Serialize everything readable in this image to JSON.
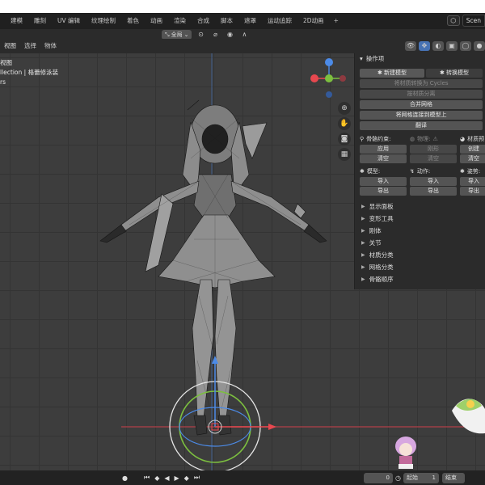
{
  "menu_tabs": [
    "建模",
    "雕刻",
    "UV 编辑",
    "纹理绘制",
    "着色",
    "动画",
    "渲染",
    "合成",
    "脚本",
    "遮罩",
    "运动追踪",
    "2D动画"
  ],
  "menu_plus": "+",
  "scene_label": "Scen",
  "header_menus": [
    "视图",
    "选择",
    "物体"
  ],
  "transform_dropdown": "全局",
  "viewport_info": {
    "line1": "视图",
    "line2": "llection | 格蕾修泳装",
    "line3": "rs"
  },
  "panel": {
    "header": "操作项",
    "new_model": "新建模型",
    "convert_model": "转换模型",
    "convert_cycles": "将材质转换为 Cycles",
    "separate_material": "按材质分离",
    "merge_mesh": "合并网格",
    "join_mesh": "将网格连接到模型上",
    "translate": "翻译",
    "bone_constraint": "骨骼约束:",
    "physics": "物理:",
    "material_short": "材质预",
    "apply": "应用",
    "clear": "清空",
    "rigid": "刚形",
    "create_short": "创建",
    "model_label": "模型:",
    "motion_label": "动作:",
    "pose_short": "姿势:",
    "import": "导入",
    "export": "导出",
    "import_short": "导入",
    "export_short": "导出",
    "sections": [
      "显示面板",
      "变形工具",
      "刚体",
      "关节",
      "材质分类",
      "网格分类",
      "骨骼顺序"
    ]
  },
  "timeline": {
    "frame": "0",
    "start_label": "起始",
    "start_value": "1",
    "end_label": "结束"
  },
  "axis_colors": {
    "x": "#e8484f",
    "y": "#7cbf3f",
    "z": "#4c8be8"
  }
}
